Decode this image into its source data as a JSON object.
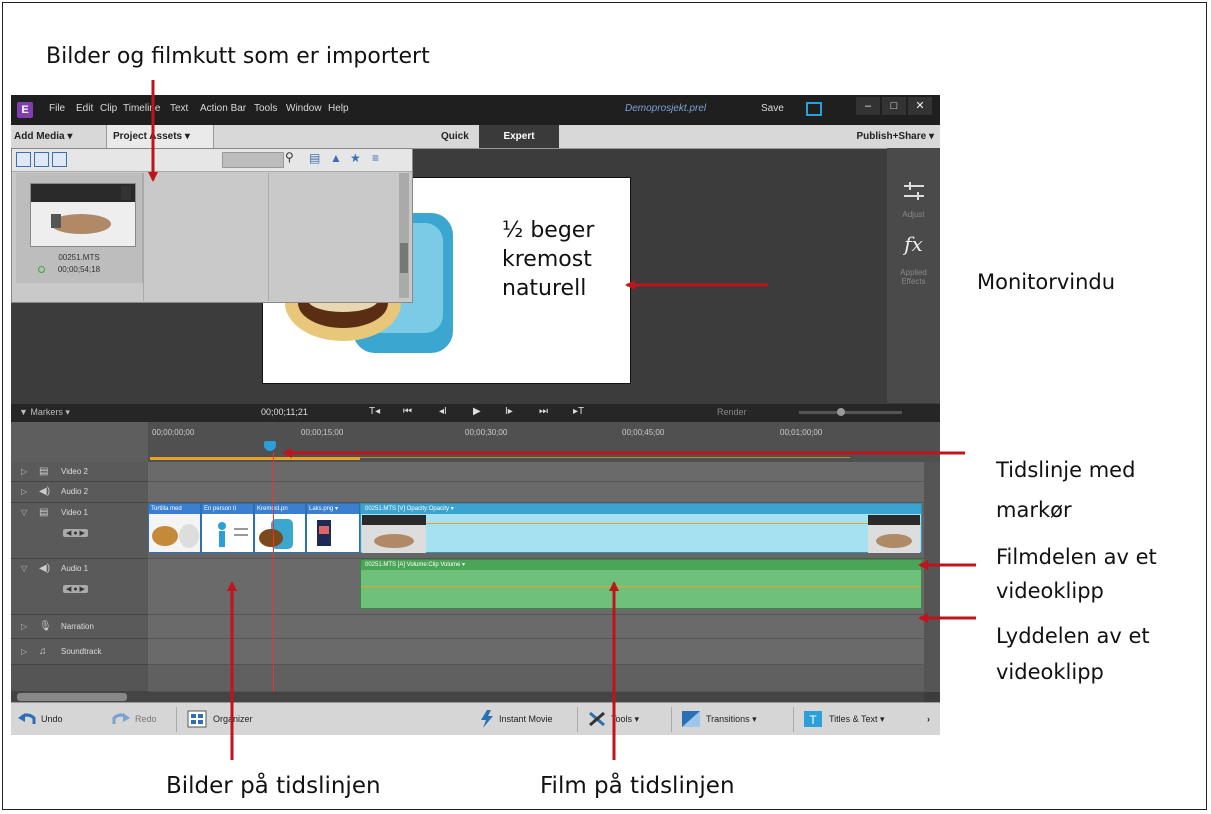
{
  "annotations": {
    "top": "Bilder og filmkutt som er importert",
    "monitor": "Monitorvindu",
    "timeline": "Tidslinje med markør",
    "film_part": "Filmdelen av et videoklipp",
    "audio_part": "Lyddelen av et videoklipp",
    "images_on_timeline": "Bilder på tidslinjen",
    "film_on_timeline": "Film på tidslinjen"
  },
  "app": {
    "logo": "E",
    "menu": [
      "File",
      "Edit",
      "Clip",
      "Timeline",
      "Text",
      "Action Bar",
      "Tools",
      "Window",
      "Help"
    ],
    "project_name": "Demoprosjekt.prel",
    "save": "Save",
    "window_buttons": [
      "–",
      "□",
      "✕"
    ]
  },
  "modebar": {
    "add_media": "Add Media ▾",
    "project_assets": "Project Assets ▾",
    "quick": "Quick",
    "expert": "Expert",
    "publish": "Publish+Share ▾"
  },
  "assets": {
    "item_name": "00251.MTS",
    "item_duration": "00;00;54;18"
  },
  "monitor": {
    "lines": [
      "½ beger",
      "kremost",
      "naturell"
    ]
  },
  "right_panel": {
    "adjust": "Adjust",
    "fx": "fx",
    "applied": "Applied Effects"
  },
  "transport": {
    "markers": "▼ Markers ▾",
    "timecode": "00;00;11;21",
    "buttons": [
      "T◂",
      "⏮",
      "◂I",
      "▶",
      "I▸",
      "⏭",
      "▸T"
    ],
    "render": "Render"
  },
  "ruler": {
    "ticks": [
      "00;00;00;00",
      "00;00;15;00",
      "00;00;30;00",
      "00;00;45;00",
      "00;01;00;00"
    ]
  },
  "tracks": [
    {
      "name": "Video 2",
      "icon": "▤"
    },
    {
      "name": "Audio 2",
      "icon": "◀)"
    },
    {
      "name": "Video 1",
      "icon": "▤"
    },
    {
      "name": "Audio 1",
      "icon": "◀)"
    },
    {
      "name": "Narration",
      "icon": "🎙"
    },
    {
      "name": "Soundtrack",
      "icon": "♫"
    }
  ],
  "image_clips": [
    "Tortilla med",
    "En person ti",
    "Kremost.pn",
    "Laks.png ▾"
  ],
  "video_clip_label": "00251.MTS [V]  Opacity:Opacity ▾",
  "audio_clip_label": "00251.MTS [A]  Volume:Clip Volume ▾",
  "actionbar": {
    "undo": "Undo",
    "redo": "Redo",
    "organizer": "Organizer",
    "instant_movie": "Instant Movie",
    "tools": "Tools ▾",
    "transitions": "Transitions ▾",
    "titles": "Titles & Text ▾"
  },
  "colors": {
    "arrow": "#c0141c",
    "accent": "#2b9fd9"
  }
}
